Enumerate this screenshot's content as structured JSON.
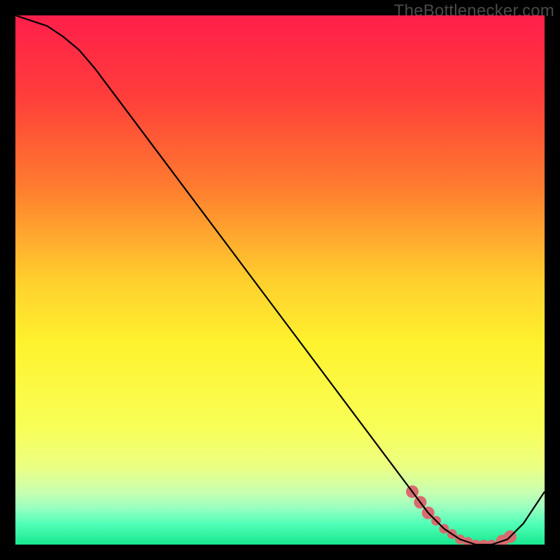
{
  "watermark": "TheBottlenecker.com",
  "chart_data": {
    "type": "line",
    "title": "",
    "xlabel": "",
    "ylabel": "",
    "xlim": [
      0,
      100
    ],
    "ylim": [
      0,
      100
    ],
    "x": [
      0,
      3,
      6,
      9,
      12,
      15,
      18,
      21,
      24,
      27,
      30,
      33,
      36,
      39,
      42,
      45,
      48,
      51,
      54,
      57,
      60,
      63,
      66,
      69,
      72,
      75,
      78,
      81,
      84,
      87,
      90,
      93,
      96,
      100
    ],
    "values": [
      100,
      99,
      98,
      96,
      93.5,
      90,
      86,
      82,
      78,
      74,
      70,
      66,
      62,
      58,
      54,
      50,
      46,
      42,
      38,
      34,
      30,
      26,
      22,
      18,
      14,
      10,
      6,
      3,
      1,
      0,
      0,
      1,
      4,
      10
    ],
    "gradient_stops": [
      {
        "pct": 0,
        "color": "#ff1f4b"
      },
      {
        "pct": 15,
        "color": "#ff3d3b"
      },
      {
        "pct": 32,
        "color": "#ff7a2f"
      },
      {
        "pct": 50,
        "color": "#ffcf2d"
      },
      {
        "pct": 62,
        "color": "#fff22e"
      },
      {
        "pct": 78,
        "color": "#f8ff58"
      },
      {
        "pct": 85,
        "color": "#ecff80"
      },
      {
        "pct": 90,
        "color": "#caffb0"
      },
      {
        "pct": 93,
        "color": "#9affc0"
      },
      {
        "pct": 96,
        "color": "#52ffb8"
      },
      {
        "pct": 100,
        "color": "#18e88f"
      }
    ],
    "marker_points_x": [
      75,
      76.5,
      78,
      79.5,
      81,
      82.5,
      84,
      85.5,
      87,
      88.5,
      90,
      92,
      93.5
    ],
    "marker_color": "#d96a6e",
    "marker_radius_primary": 9,
    "marker_radius_secondary": 7,
    "line_color": "#000000",
    "line_width": 2.2
  }
}
